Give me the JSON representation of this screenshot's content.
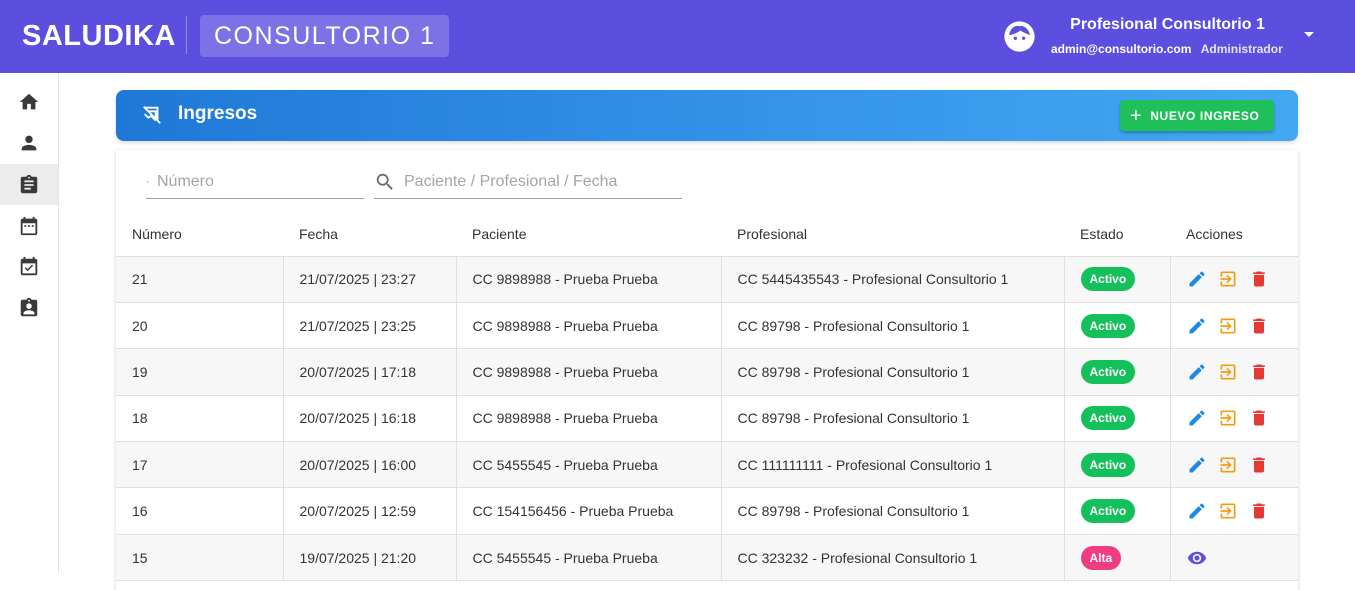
{
  "app": {
    "brand": "SALUDIKA",
    "office": "CONSULTORIO 1"
  },
  "user": {
    "name": "Profesional Consultorio 1",
    "email": "admin@consultorio.com",
    "role": "Administrador"
  },
  "nav": {
    "items": [
      "home-icon",
      "person-icon",
      "clipboard-icon",
      "calendar-icon",
      "calendar-check-icon",
      "badge-icon"
    ],
    "active_index": 2
  },
  "header": {
    "title": "Ingresos",
    "new_button": "NUEVO INGRESO"
  },
  "filters": {
    "number_placeholder": "Número",
    "search_placeholder": "Paciente / Profesional / Fecha"
  },
  "table": {
    "columns": [
      "Número",
      "Fecha",
      "Paciente",
      "Profesional",
      "Estado",
      "Acciones"
    ],
    "rows": [
      {
        "numero": "21",
        "fecha": "21/07/2025 | 23:27",
        "paciente": "CC 9898988 - Prueba Prueba",
        "profesional": "CC 5445435543 - Profesional Consultorio 1",
        "estado": "Activo"
      },
      {
        "numero": "20",
        "fecha": "21/07/2025 | 23:25",
        "paciente": "CC 9898988 - Prueba Prueba",
        "profesional": "CC 89798 - Profesional Consultorio 1",
        "estado": "Activo"
      },
      {
        "numero": "19",
        "fecha": "20/07/2025 | 17:18",
        "paciente": "CC 9898988 - Prueba Prueba",
        "profesional": "CC 89798 - Profesional Consultorio 1",
        "estado": "Activo"
      },
      {
        "numero": "18",
        "fecha": "20/07/2025 | 16:18",
        "paciente": "CC 9898988 - Prueba Prueba",
        "profesional": "CC 89798 - Profesional Consultorio 1",
        "estado": "Activo"
      },
      {
        "numero": "17",
        "fecha": "20/07/2025 | 16:00",
        "paciente": "CC 5455545 - Prueba Prueba",
        "profesional": "CC 111111111 - Profesional Consultorio 1",
        "estado": "Activo"
      },
      {
        "numero": "16",
        "fecha": "20/07/2025 | 12:59",
        "paciente": "CC 154156456 - Prueba Prueba",
        "profesional": "CC 89798 - Profesional Consultorio 1",
        "estado": "Activo"
      },
      {
        "numero": "15",
        "fecha": "19/07/2025 | 21:20",
        "paciente": "CC 5455545 - Prueba Prueba",
        "profesional": "CC 323232 - Profesional Consultorio 1",
        "estado": "Alta"
      }
    ]
  },
  "colors": {
    "topbar": "#5c4fe0",
    "header_gradient_start": "#1f78d6",
    "header_gradient_end": "#43a8f3",
    "primary_button": "#1fc05a",
    "badge_activo": "#14c05a",
    "badge_alta": "#f03c82",
    "edit_icon": "#1e88e5",
    "discharge_icon": "#f39c12",
    "delete_icon": "#e53935",
    "view_icon": "#5c4fe0"
  }
}
